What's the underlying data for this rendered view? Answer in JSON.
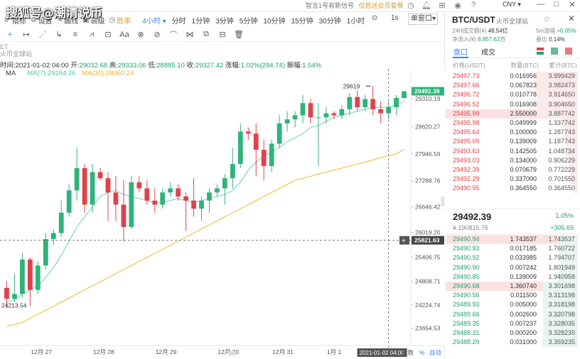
{
  "watermark": "搜狐号@潮清说币",
  "topbar": {
    "notice": "智言1号有新信号",
    "vip": "仅首送会员套餐",
    "currency": "CNY",
    "currency_caret": "▾",
    "min": "—",
    "max": "□",
    "close": "✕"
  },
  "toolbar": {
    "items": [
      {
        "icon": "indicator-icon",
        "glyph": "⊪",
        "label": "指标"
      },
      {
        "icon": "settings-icon",
        "glyph": "⚙",
        "label": "设置"
      },
      {
        "icon": "drawing-icon",
        "glyph": "✎",
        "label": "画线"
      },
      {
        "icon": "advanced-icon",
        "glyph": "▣",
        "label": "高级"
      },
      {
        "icon": "win-rate-icon",
        "glyph": "◷",
        "label": "胜率"
      }
    ],
    "interval_selected": "4小时",
    "intervals": [
      "分时",
      "1分钟",
      "3分钟",
      "5分钟",
      "10分钟",
      "15分钟",
      "30分钟",
      "1小时"
    ],
    "second_1s": "1s",
    "layout_select": "单窗口",
    "layout_caret": "▾"
  },
  "draw_tools": [
    "+",
    "↦",
    "⋰",
    "↳",
    "≡",
    "⩘",
    "⊡",
    "Aa",
    "⊗",
    "⊘",
    "⌒",
    "⋈",
    "⧉",
    "⊟",
    "🗑"
  ],
  "ohlc": {
    "time_label": "时间:",
    "time": "2021-01-02 04:00",
    "open_label": "开:",
    "open": "29032.68",
    "high_label": "高:",
    "high": "29333.06",
    "low_label": "低:",
    "low": "28885.10",
    "close_label": "收:",
    "close": "29327.42",
    "chg_label": "涨幅:",
    "chg": "1.02%(294.74)",
    "amp_label": "振幅:",
    "amp": "1.54%"
  },
  "ma": {
    "label": "MA",
    "ma7": "MA(7):29164.26",
    "ma30": "MA(30):28060.24"
  },
  "et_peek": [
    "ET",
    "火币全球站"
  ],
  "chart_data": {
    "type": "candlestick",
    "y_ticks": [
      29310.19,
      28620.27,
      27946.59,
      27288.76,
      26646.42,
      26019.2,
      25406.75,
      24808.71,
      24224.74,
      23654.53
    ],
    "ylim": [
      23370,
      29870
    ],
    "x_ticks": [
      "12月 27",
      "12月 28",
      "12月 29",
      "12月 30",
      "12月 31",
      "1月 1",
      "2021-01-02 04:00"
    ],
    "last_price_tag": "29492.39",
    "crosshair_price_tag": "25821.63",
    "crosshair_plus": "+",
    "high_marker": "29619",
    "low_marker": "24213.54",
    "axis_controls": [
      "对数",
      "%",
      "自动"
    ],
    "candles": [
      [
        24650,
        24820,
        24150,
        24380
      ],
      [
        24380,
        25000,
        24300,
        24500
      ],
      [
        24500,
        25500,
        24400,
        25350
      ],
      [
        25350,
        25400,
        24200,
        24600
      ],
      [
        24600,
        25300,
        24500,
        25200
      ],
      [
        25200,
        26000,
        25100,
        25850
      ],
      [
        25850,
        26100,
        25700,
        26000
      ],
      [
        26000,
        26800,
        25900,
        26500
      ],
      [
        26500,
        27200,
        26400,
        27050
      ],
      [
        27050,
        28100,
        26800,
        27600
      ],
      [
        27600,
        27700,
        26500,
        26700
      ],
      [
        26700,
        27700,
        26500,
        27500
      ],
      [
        27500,
        27600,
        27300,
        27350
      ],
      [
        27350,
        27500,
        26300,
        27000
      ],
      [
        27000,
        27400,
        26300,
        26700
      ],
      [
        26700,
        27300,
        25800,
        26150
      ],
      [
        26150,
        27400,
        26100,
        27250
      ],
      [
        27250,
        27400,
        27000,
        27100
      ],
      [
        27100,
        27300,
        26700,
        26800
      ],
      [
        26800,
        27100,
        26500,
        26700
      ],
      [
        26700,
        27100,
        26600,
        27000
      ],
      [
        27000,
        27250,
        26900,
        27100
      ],
      [
        27100,
        27200,
        26800,
        26900
      ],
      [
        26900,
        27000,
        26050,
        26800
      ],
      [
        26800,
        27350,
        26400,
        26600
      ],
      [
        26600,
        26900,
        26300,
        26800
      ],
      [
        26800,
        27100,
        26500,
        27000
      ],
      [
        27000,
        27200,
        26900,
        27100
      ],
      [
        27100,
        27450,
        26700,
        27350
      ],
      [
        27350,
        28100,
        27100,
        27700
      ],
      [
        27700,
        28700,
        27600,
        28500
      ],
      [
        28500,
        28600,
        28300,
        28450
      ],
      [
        28450,
        28700,
        27400,
        28050
      ],
      [
        28050,
        28300,
        27300,
        27650
      ],
      [
        27650,
        28300,
        27500,
        28200
      ],
      [
        28200,
        28900,
        28100,
        28700
      ],
      [
        28700,
        29000,
        28500,
        28800
      ],
      [
        28800,
        29000,
        28600,
        28900
      ],
      [
        28900,
        29400,
        28700,
        29200
      ],
      [
        29200,
        29300,
        28700,
        28850
      ],
      [
        28850,
        29200,
        27650,
        28850
      ],
      [
        28850,
        29100,
        28700,
        28950
      ],
      [
        28950,
        29000,
        28800,
        28900
      ],
      [
        28900,
        29150,
        28800,
        29050
      ],
      [
        29050,
        29450,
        28900,
        29350
      ],
      [
        29350,
        29500,
        29000,
        29100
      ],
      [
        29100,
        29400,
        29000,
        29300
      ],
      [
        29300,
        29619,
        28900,
        29050
      ],
      [
        29050,
        29250,
        28700,
        28950
      ],
      [
        28950,
        29250,
        28800,
        29100
      ],
      [
        29100,
        29400,
        28900,
        29327
      ],
      [
        29327,
        29500,
        29300,
        29492
      ]
    ],
    "ma7": [
      24300,
      24350,
      24500,
      24600,
      24700,
      24900,
      25150,
      25450,
      25800,
      26150,
      26400,
      26650,
      26900,
      27000,
      27050,
      26950,
      26900,
      26850,
      26800,
      26750,
      26750,
      26800,
      26850,
      26800,
      26750,
      26800,
      26850,
      26900,
      26950,
      27050,
      27250,
      27550,
      27750,
      27900,
      28000,
      28100,
      28250,
      28350,
      28450,
      28600,
      28650,
      28750,
      28850,
      28900,
      28950,
      29000,
      29050,
      29100,
      29100,
      29100,
      29150,
      29250
    ],
    "ma30": [
      23700,
      23750,
      23800,
      23900,
      24000,
      24100,
      24200,
      24300,
      24400,
      24500,
      24600,
      24700,
      24800,
      24900,
      25000,
      25100,
      25200,
      25300,
      25400,
      25500,
      25600,
      25700,
      25800,
      25900,
      26000,
      26100,
      26200,
      26300,
      26400,
      26500,
      26600,
      26700,
      26800,
      26900,
      27000,
      27100,
      27200,
      27300,
      27350,
      27400,
      27450,
      27500,
      27550,
      27600,
      27650,
      27700,
      27750,
      27800,
      27850,
      27900,
      27950,
      28060
    ]
  },
  "book": {
    "pair": "BTC/USDT",
    "exchange": "火币全球站",
    "star": "☆",
    "close": "✕",
    "vol_label": "24H成交额(¥)",
    "vol": "48.54亿",
    "chg5m_label": "5m涨幅",
    "chg5m": "+0.05%",
    "net_label": "净流入(¥)",
    "net": "8,857.62万",
    "wr_label": "委比",
    "wr": "0.14%",
    "tab_book": "盘口",
    "tab_trades": "成交",
    "col_price": "价格(USDT)",
    "col_amount": "数量(BTC)",
    "col_total": "累计(BTC)",
    "asks": [
      {
        "price": "29497.73",
        "amount": "0.016956",
        "total": "3.999429",
        "depth": 0.99
      },
      {
        "price": "29497.66",
        "amount": "0.067823",
        "total": "3.982473",
        "depth": 0.98
      },
      {
        "price": "29496.72",
        "amount": "0.010778",
        "total": "3.914650",
        "depth": 0.96
      },
      {
        "price": "29496.52",
        "amount": "0.016908",
        "total": "3.904650",
        "depth": 0.96
      },
      {
        "price": "29495.99",
        "amount": "2.550000",
        "total": "3.887742",
        "depth": 0.95,
        "hl": true
      },
      {
        "price": "29495.98",
        "amount": "0.049999",
        "total": "1.337742",
        "depth": 0.33
      },
      {
        "price": "29495.64",
        "amount": "0.100000",
        "total": "1.287743",
        "depth": 0.32
      },
      {
        "price": "29495.09",
        "amount": "0.139009",
        "total": "1.187743",
        "depth": 0.29
      },
      {
        "price": "29493.63",
        "amount": "0.142505",
        "total": "1.048734",
        "depth": 0.26
      },
      {
        "price": "29493.03",
        "amount": "0.134000",
        "total": "0.906229",
        "depth": 0.22
      },
      {
        "price": "29492.39",
        "amount": "0.070679",
        "total": "0.772229",
        "depth": 0.19
      },
      {
        "price": "29492.29",
        "amount": "0.337000",
        "total": "0.701550",
        "depth": 0.17
      },
      {
        "price": "29490.95",
        "amount": "0.364550",
        "total": "0.364550",
        "depth": 0.09
      }
    ],
    "mid_price": "29492.39",
    "mid_pct": "1.05%",
    "mid_cny": "¥ 190815.76",
    "mid_chg": "+305.69",
    "bids": [
      {
        "price": "29490.94",
        "amount": "1.743537",
        "total": "1.743537",
        "depth": 0.43,
        "hl": true
      },
      {
        "price": "29490.93",
        "amount": "0.017185",
        "total": "1.760722",
        "depth": 0.43
      },
      {
        "price": "29490.92",
        "amount": "0.033985",
        "total": "1.794707",
        "depth": 0.44
      },
      {
        "price": "29490.90",
        "amount": "0.007242",
        "total": "1.801949",
        "depth": 0.44
      },
      {
        "price": "29490.85",
        "amount": "0.139009",
        "total": "1.940958",
        "depth": 0.48
      },
      {
        "price": "29490.68",
        "amount": "1.360740",
        "total": "3.301698",
        "depth": 0.81,
        "hl": true
      },
      {
        "price": "29490.56",
        "amount": "0.011500",
        "total": "3.313198",
        "depth": 0.82
      },
      {
        "price": "29489.93",
        "amount": "0.005000",
        "total": "3.318198",
        "depth": 0.82
      },
      {
        "price": "29489.66",
        "amount": "0.002600",
        "total": "3.320798",
        "depth": 0.82
      },
      {
        "price": "29489.35",
        "amount": "0.007237",
        "total": "3.328035",
        "depth": 0.82
      },
      {
        "price": "29488.31",
        "amount": "0.000200",
        "total": "3.328235",
        "depth": 0.82
      },
      {
        "price": "29488.29",
        "amount": "0.031000",
        "total": "3.359235",
        "depth": 0.83
      }
    ]
  }
}
